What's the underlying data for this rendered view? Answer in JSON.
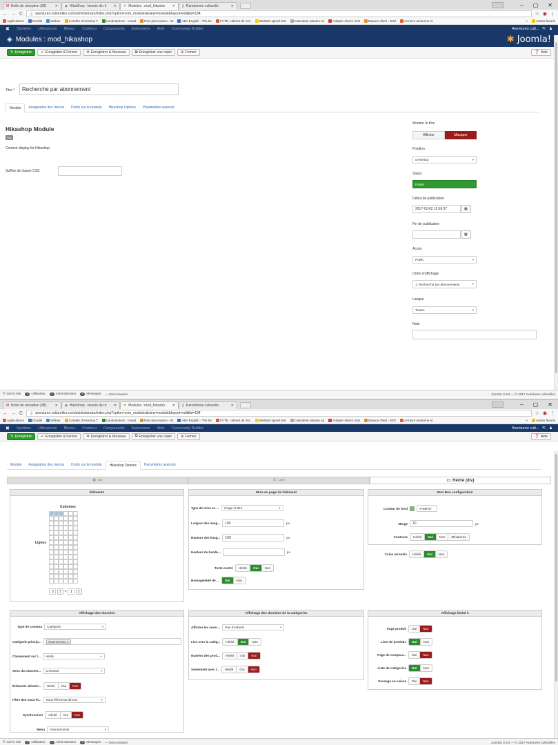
{
  "browser": {
    "tabs": [
      {
        "label": "Boîte de réception (38) -",
        "icon": "gmail-icon"
      },
      {
        "label": "HikaShop - besoin de ré",
        "icon": "hikashop-icon"
      },
      {
        "label": "Modules : mod_hikasho",
        "icon": "joomla-icon"
      },
      {
        "label": "Randonnée culturelle",
        "icon": "page-icon"
      }
    ],
    "url": "aventures-culturelles.com/administrator/index.php?option=com_modules&view=module&layout=edit&id=184",
    "bookmarks": [
      "Applications",
      "Doodle",
      "Webex",
      "L'Atelier d'Anissina T",
      "Lendosphere : crowd",
      "Pain pita maison - W",
      "ABA English - The be",
      "FVTE, cabinet de recr",
      "Website speed test",
      "Calendrier plantes sa",
      "Adopter Akemi chat",
      "Espace client - EKZ",
      "Armoire ancienne Ar",
      "»",
      "Autres favoris"
    ]
  },
  "joomla": {
    "nav": [
      "Système",
      "Utilisateurs",
      "Menus",
      "Contenu",
      "Composants",
      "Extensions",
      "Aide",
      "Community Builder"
    ],
    "site_label": "Aventures cult...",
    "page_title": "Modules : mod_hikashop",
    "brand": "Joomla!",
    "toolbar": {
      "save": "Enregistrer",
      "save_close": "Enregistrer & Fermer",
      "save_new": "Enregistrer & Nouveau",
      "save_copy": "Enregistrer une copie",
      "close": "Fermer",
      "help": "Aide"
    },
    "title_label": "Titre *",
    "title_value": "Recherche par abonnement",
    "tabs": [
      "Module",
      "Assignation des menus",
      "Droits sur le module",
      "Hikashop Options",
      "Paramètres avancés"
    ],
    "module_heading": "Hikashop Module",
    "site_badge": "Site",
    "module_desc": "Content display for Hikashop",
    "css_suffix_label": "Suffixe de classe CSS",
    "sidebar": {
      "show_title_label": "Montrer le titre",
      "show": "Afficher",
      "hide": "Masquer",
      "position_label": "Position",
      "position_value": "centertop",
      "status_label": "Statut",
      "status_value": "Publié",
      "pub_start_label": "Début de publication",
      "pub_start_value": "2017-02-02 11:56:37",
      "pub_end_label": "Fin de publication",
      "access_label": "Accès",
      "access_value": "Public",
      "order_label": "Ordre d'affichage",
      "order_value": "1. Recherche par abonnements",
      "language_label": "Langue",
      "language_value": "Toutes",
      "note_label": "Note"
    },
    "status_bar": {
      "view_site": "Voir le site",
      "visitor_count": "0",
      "visitor": "Utilisateur",
      "admin_count": "1",
      "admin": "Administrateur",
      "messages_count": "0",
      "messages": "Messages",
      "logout": "Déconnexion",
      "version": "Joomla! 3.6.5 — © 2017 Aventures culturelles"
    }
  },
  "hika": {
    "layouts": [
      "Div",
      "Liste",
      "Hérité (div)"
    ],
    "elements": {
      "title": "Eléments",
      "columns_label": "Colonnes",
      "rows_label": "Lignes",
      "rows_value": "3",
      "columns_value": "1",
      "times": "x",
      "grid_filled_columns": 3,
      "grid_filled_rows": 1
    },
    "page_layout": {
      "title": "Mise en page de l'élément",
      "fields": [
        {
          "label": "Type de mise en ...",
          "kind": "select",
          "value": "Image et titre"
        },
        {
          "label": "Largeur des imag...",
          "kind": "input",
          "value": "100",
          "unit": "px"
        },
        {
          "label": "Hauteur des imag...",
          "kind": "input",
          "value": "100",
          "unit": "px"
        },
        {
          "label": "Hauteur du bande...",
          "kind": "input",
          "value": "",
          "unit": "px"
        }
      ],
      "center_text_label": "Texte centré",
      "center_text": [
        "Hérité",
        "Oui",
        "Non"
      ],
      "homog_label": "Homogénéité de ...",
      "homog": [
        "Oui",
        "Non"
      ]
    },
    "item_box": {
      "title": "Item Box configuration",
      "bg_label": "Couleur de fond",
      "bg_value": "#76BF67",
      "bg_color": "#76bf67",
      "margin_label": "Marge",
      "margin_value": "10",
      "margin_unit": "px",
      "borders_label": "Contours",
      "borders": [
        "Hérité",
        "Oui",
        "Non",
        "Miniatures"
      ],
      "rounded_label": "Coins arrondis",
      "rounded": [
        "Hérité",
        "Oui",
        "Non"
      ]
    },
    "data_display": {
      "title": "Affichage des données",
      "content_type_label": "Type de contenu",
      "content_type": "Catégorie",
      "main_cat_label": "Catégorie princip...",
      "main_cat_tag": "Abonnements",
      "sort_label": "Classement sur l...",
      "sort_value": "Hérité",
      "sort_dir_label": "Sens du classem...",
      "sort_dir_value": "Croissant",
      "random_label": "Eléments aléatoir...",
      "random": [
        "Hérité",
        "Oui",
        "Non"
      ],
      "filter_label": "Filtre des sous-él...",
      "filter_value": "Sous-éléments directs",
      "sync_label": "Synchroniser",
      "sync": [
        "Hérité",
        "Oui",
        "Non"
      ],
      "menu_label": "Menu",
      "menu_value": "Abonnements"
    },
    "cat_display": {
      "title": "Affichage des données de la catégories",
      "show_sub_label": "Afficher les sous-...",
      "show_sub_value": "Pas d'enfants",
      "link_label": "Lien vers la catég...",
      "link": [
        "Hérité",
        "Oui",
        "Non"
      ],
      "number_label": "Numéro des prod...",
      "number": [
        "Hérité",
        "Oui",
        "Non"
      ],
      "only_label": "Seulement avec l...",
      "only": [
        "Hérité",
        "Oui",
        "Non"
      ]
    },
    "limited": {
      "title": "Affichage limité à",
      "rows": [
        {
          "label": "Page produit",
          "active": "Non"
        },
        {
          "label": "Liste de produits",
          "active": "Oui"
        },
        {
          "label": "Page de compara...",
          "active": "Non"
        },
        {
          "label": "Liste de catégories",
          "active": "Oui"
        },
        {
          "label": "Passage en caisse",
          "active": "Non"
        }
      ],
      "yes": "Oui",
      "no": "Non"
    }
  },
  "colors": {
    "navy": "#1a3867",
    "green": "#2f8a2f",
    "red": "#9b1c1c",
    "accent_orange": "#f9a541"
  }
}
